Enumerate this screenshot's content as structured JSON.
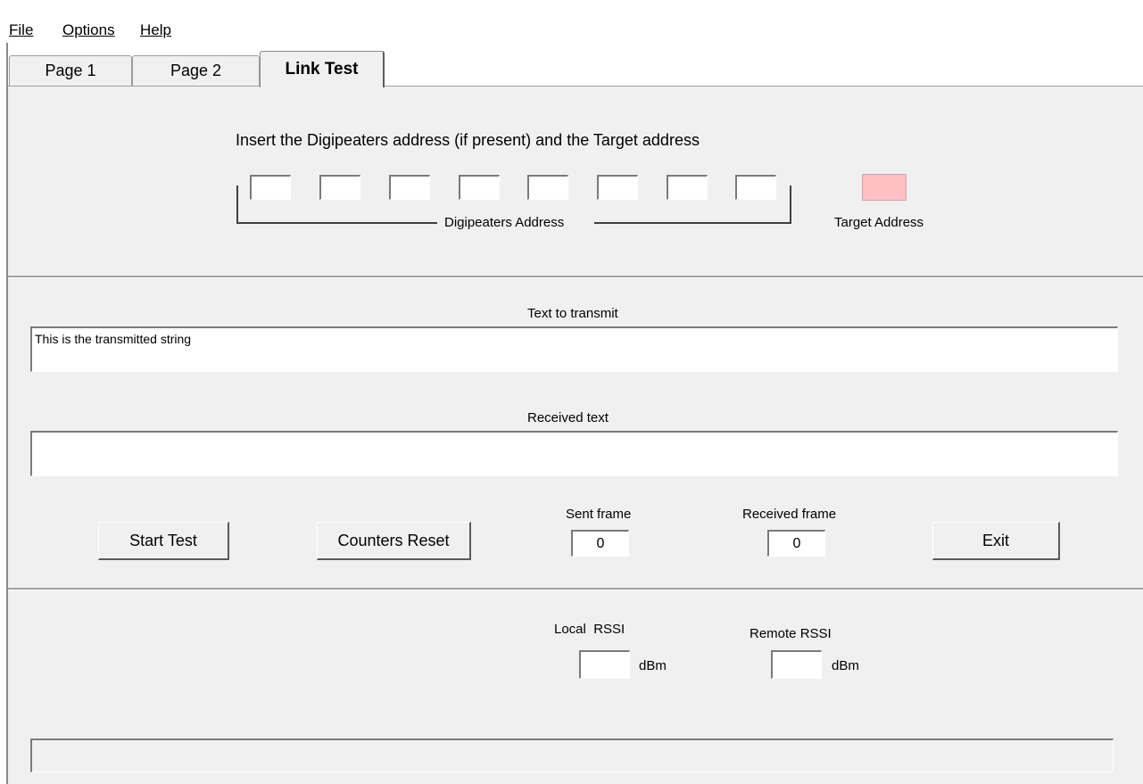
{
  "menu": {
    "file": "File",
    "options": "Options",
    "help": "Help"
  },
  "tabs": [
    {
      "label": "Page 1"
    },
    {
      "label": "Page 2"
    },
    {
      "label": "Link Test"
    }
  ],
  "address_section": {
    "instruction": "Insert the Digipeaters address (if present) and the Target address",
    "digipeaters_label": "Digipeaters Address",
    "digipeaters_values": [
      "",
      "",
      "",
      "",
      "",
      "",
      "",
      ""
    ],
    "target_label": "Target Address",
    "target_value": ""
  },
  "transmit": {
    "label": "Text to transmit",
    "value": "This is the transmitted string"
  },
  "received": {
    "label": "Received text",
    "value": ""
  },
  "buttons": {
    "start_test": "Start Test",
    "counters_reset": "Counters Reset",
    "exit": "Exit"
  },
  "counters": {
    "sent_label": "Sent frame",
    "sent_value": "0",
    "received_label": "Received frame",
    "received_value": "0"
  },
  "rssi": {
    "local_label": "Local  RSSI",
    "local_value": "",
    "local_unit": "dBm",
    "remote_label": "Remote RSSI",
    "remote_value": "",
    "remote_unit": "dBm"
  },
  "status_bar": {
    "value": ""
  },
  "colors": {
    "target_box": "#ffc0c4",
    "panel_bg": "#f0f0f0"
  }
}
